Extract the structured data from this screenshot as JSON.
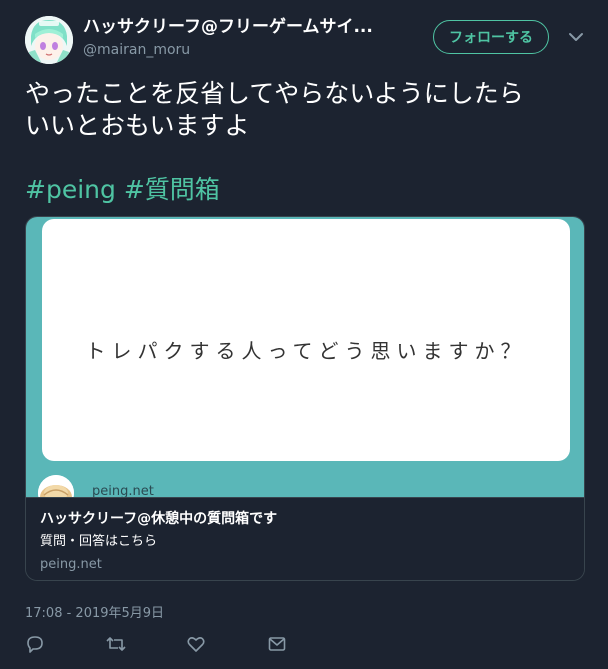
{
  "author": {
    "display_name": "ハッサクリーフ@フリーゲームサイ...",
    "handle": "@mairan_moru",
    "avatar_icon": "avatar-image"
  },
  "follow_button": {
    "label": "フォローする"
  },
  "tweet": {
    "text_line1": "やったことを反省してやらないようにしたら",
    "text_line2": "いいとおもいますよ",
    "hashtags": [
      "#peing",
      "#質問箱"
    ],
    "timestamp": "17:08 - 2019年5月9日"
  },
  "card": {
    "question_text": "トレパクする人ってどう思いますか？",
    "image_domain": "peing.net",
    "title": "ハッサクリーフ@休憩中の質問箱です",
    "description": "質問・回答はこちら",
    "domain": "peing.net"
  },
  "actions": [
    {
      "name": "reply-icon"
    },
    {
      "name": "retweet-icon"
    },
    {
      "name": "like-icon"
    },
    {
      "name": "message-icon"
    }
  ],
  "colors": {
    "background": "#1c2330",
    "accent": "#4fc4a3",
    "muted": "#8899a6",
    "card_teal": "#5ab7b8"
  }
}
